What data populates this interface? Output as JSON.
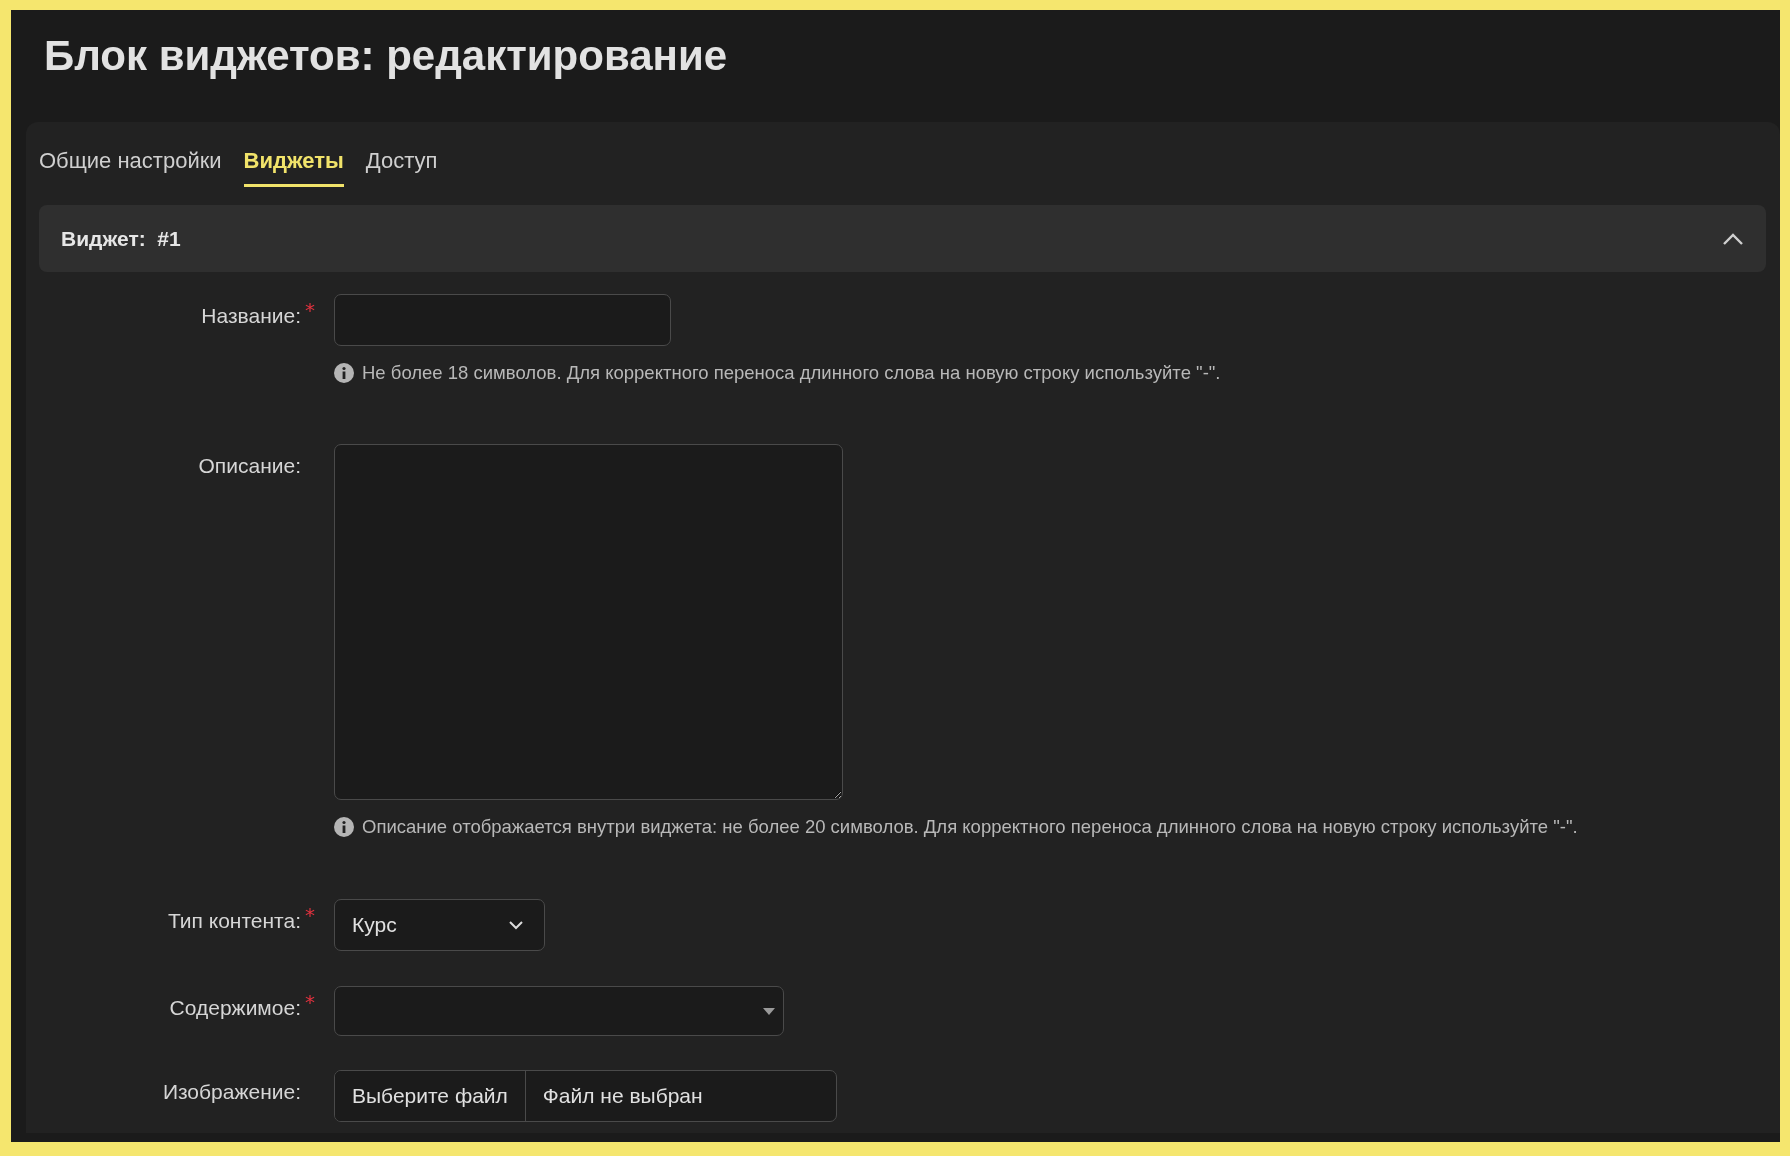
{
  "page": {
    "title": "Блок виджетов: редактирование"
  },
  "tabs": [
    {
      "label": "Общие настройки",
      "selected": false
    },
    {
      "label": "Виджеты",
      "selected": true
    },
    {
      "label": "Доступ",
      "selected": false
    }
  ],
  "widget": {
    "title": "Виджет:  #1",
    "expanded": true,
    "fields": [
      {
        "kind": "text",
        "label": "Название:",
        "required": true,
        "marker": "*",
        "hint": "Не более 18 символов. Для корректного переноса длинного слова на новую строку используйте \"-\"."
      },
      {
        "kind": "textarea",
        "label": "Описание:",
        "required": false,
        "hint": "Описание отображается внутри виджета: не более 20 символов. Для корректного переноса длинного слова на новую строку используйте \"-\"."
      },
      {
        "kind": "select",
        "label": "Тип контента:",
        "required": true,
        "marker": "*",
        "value": "Курс"
      },
      {
        "kind": "combo",
        "label": "Содержимое:",
        "required": true,
        "marker": "*"
      },
      {
        "kind": "file",
        "label": "Изображение:",
        "required": false,
        "button": "Выберите файл",
        "value": "Файл не выбран"
      }
    ]
  }
}
